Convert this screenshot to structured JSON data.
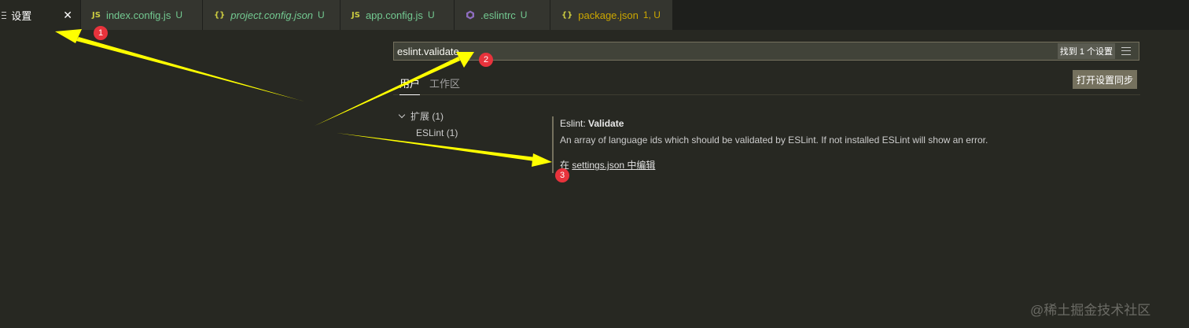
{
  "tabs": [
    {
      "icon": "menu",
      "label": "设置",
      "status": "",
      "active": true,
      "italic": false,
      "close": "✕"
    },
    {
      "icon": "JS",
      "label": "index.config.js",
      "status": "U",
      "active": false,
      "italic": false
    },
    {
      "icon": "{}",
      "label": "project.config.json",
      "status": "U",
      "active": false,
      "italic": true
    },
    {
      "icon": "JS",
      "label": "app.config.js",
      "status": "U",
      "active": false,
      "italic": false
    },
    {
      "icon": "eslint",
      "label": ".eslintrc",
      "status": "U",
      "active": false,
      "italic": false
    },
    {
      "icon": "{}",
      "label": "package.json",
      "status": "1, U",
      "active": false,
      "italic": false
    }
  ],
  "search": {
    "value": "eslint.validate",
    "result_count": "找到 1 个设置"
  },
  "scope": {
    "user": "用户",
    "workspace": "工作区"
  },
  "sync_button": "打开设置同步",
  "toc": {
    "group": "扩展 (1)",
    "item": "ESLint (1)"
  },
  "setting": {
    "category": "Eslint: ",
    "name": "Validate",
    "description": "An array of language ids which should be validated by ESLint. If not installed ESLint will show an error.",
    "link_prefix": "在 ",
    "link_text": "settings.json 中编辑"
  },
  "annotations": [
    "1",
    "2",
    "3"
  ],
  "watermark": "@稀土掘金技术社区",
  "colors": {
    "background": "#272822",
    "arrow": "#ffff00",
    "badge": "#e8333c"
  }
}
